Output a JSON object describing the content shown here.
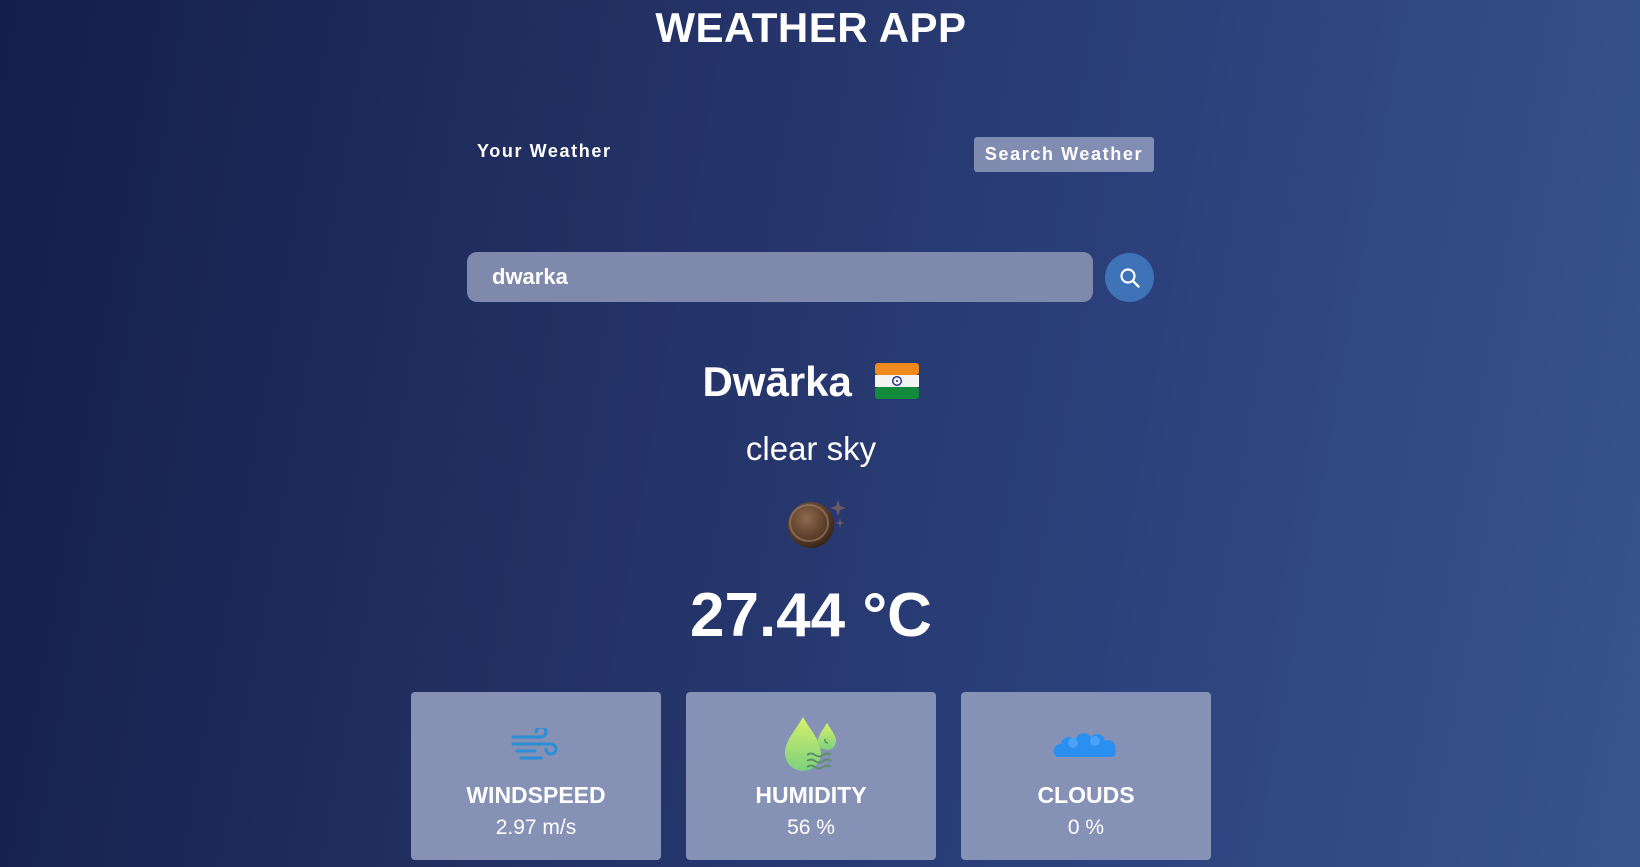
{
  "header": {
    "title": "WEATHER APP"
  },
  "tabs": [
    {
      "label": "Your Weather",
      "active": false
    },
    {
      "label": "Search Weather",
      "active": true
    }
  ],
  "search": {
    "value": "dwarka",
    "button_icon": "search-icon"
  },
  "weather": {
    "city": "Dwārka",
    "country_flag_icon": "india-flag-icon",
    "description": "clear sky",
    "condition_icon": "clear-sky-night-icon",
    "temperature": "27.44 °C"
  },
  "stats": [
    {
      "label": "WINDSPEED",
      "value": "2.97 m/s",
      "icon": "wind-icon"
    },
    {
      "label": "HUMIDITY",
      "value": "56 %",
      "icon": "humidity-icon"
    },
    {
      "label": "CLOUDS",
      "value": "0 %",
      "icon": "clouds-icon"
    }
  ],
  "colors": {
    "background_start": "#141e4a",
    "background_end": "#37558f",
    "search_button": "#3f73b8",
    "card_bg": "#8592b6"
  }
}
